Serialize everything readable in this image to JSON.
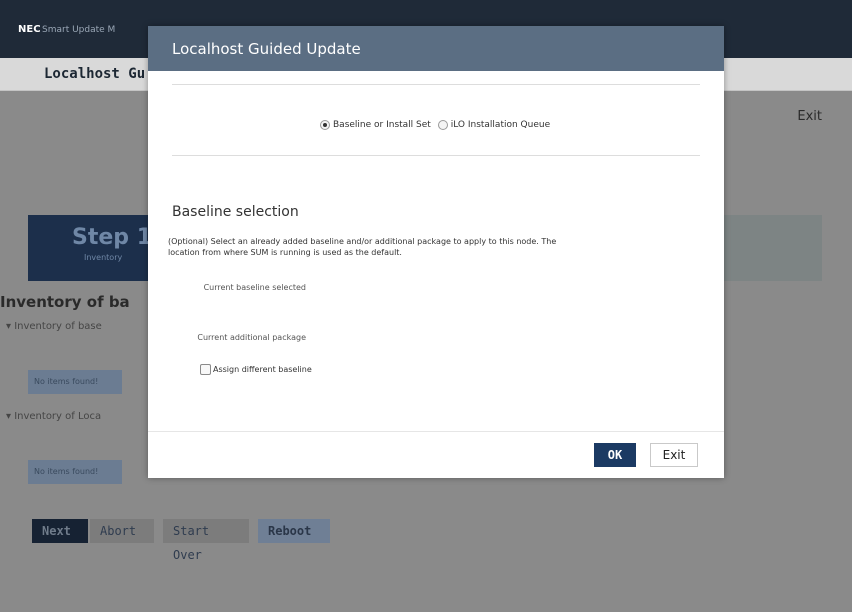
{
  "app": {
    "logo": "NEC",
    "title": "Smart Update M"
  },
  "page": {
    "title": "Localhost Gu",
    "exit_link": "Exit",
    "step": {
      "number": "Step 1",
      "subtitle": "Inventory"
    },
    "inventory_title": "Inventory of ba",
    "inventory_baseline_toggle": "▾ Inventory of base",
    "inventory_localhost_toggle": "▾ Inventory of Loca",
    "no_items_1": "No items found!",
    "no_items_2": "No items found!",
    "buttons": {
      "next": "Next",
      "abort": "Abort",
      "start_over": "Start Over",
      "reboot": "Reboot"
    }
  },
  "modal": {
    "title": "Localhost Guided Update",
    "radio_options": [
      {
        "label": "Baseline or Install Set",
        "selected": true
      },
      {
        "label": "iLO Installation Queue",
        "selected": false
      }
    ],
    "section_title": "Baseline selection",
    "description": "(Optional) Select an already added baseline and/or additional package to apply to this node. The location from where SUM is running is used as the default.",
    "current_baseline_label": "Current baseline selected",
    "current_package_label": "Current additional package",
    "assign_checkbox_label": "Assign different baseline",
    "assign_checked": false,
    "ok_button": "OK",
    "exit_button": "Exit"
  },
  "colors": {
    "modal_header": "#5b6e83",
    "primary_button": "#1b3a63",
    "topbar": "#1f2a38"
  }
}
